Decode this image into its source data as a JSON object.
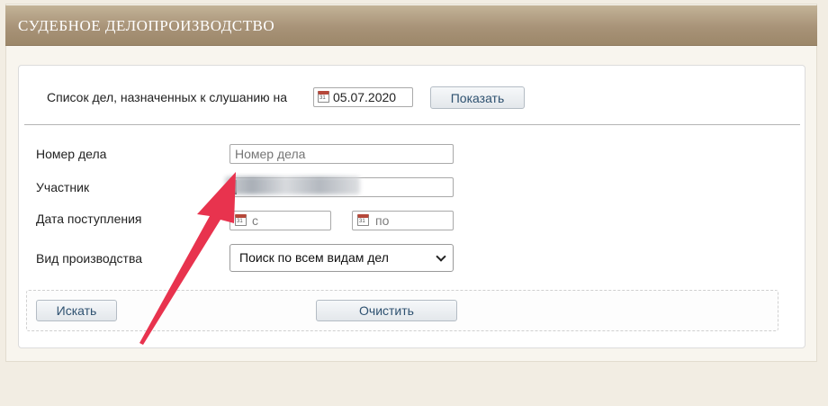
{
  "header": {
    "title": "СУДЕБНОЕ ДЕЛОПРОИЗВОДСТВО"
  },
  "schedule": {
    "label": "Список дел, назначенных к слушанию на",
    "date": "05.07.2020",
    "show_button": "Показать"
  },
  "form": {
    "case_number": {
      "label": "Номер дела",
      "placeholder": "Номер дела"
    },
    "participant": {
      "label": "Участник"
    },
    "date_received": {
      "label": "Дата поступления",
      "from_placeholder": "с",
      "to_placeholder": "по"
    },
    "proceeding_type": {
      "label": "Вид производства",
      "selected": "Поиск по всем видам дел"
    }
  },
  "actions": {
    "search_button": "Искать",
    "clear_button": "Очистить"
  },
  "colors": {
    "header_bg": "#a89378",
    "page_bg": "#f2ede3",
    "arrow": "#e8334e",
    "button_text": "#2e5170"
  },
  "icons": {
    "calendar": "calendar-icon",
    "dropdown": "chevron-down-icon",
    "annotation": "arrow-annotation"
  }
}
